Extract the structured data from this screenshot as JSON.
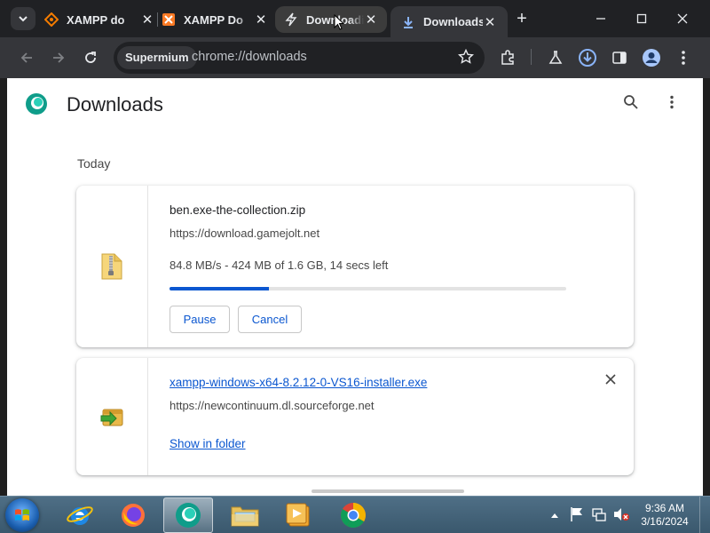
{
  "browser": {
    "tabs": [
      {
        "title": "XAMPP do",
        "icon": "xampp-diamond-icon",
        "active": false
      },
      {
        "title": "XAMPP Do",
        "icon": "xampp-logo-icon",
        "active": false
      },
      {
        "title": "Downloadi",
        "icon": "lightning-icon",
        "active": false,
        "hovered": true
      },
      {
        "title": "Downloads",
        "icon": "download-arrow-icon",
        "active": true
      }
    ],
    "profile_chip": "Supermium",
    "url": "chrome://downloads",
    "accent": "#0b57d0"
  },
  "page": {
    "title": "Downloads",
    "section_date": "Today",
    "downloads": [
      {
        "filename": "ben.exe-the-collection.zip",
        "source": "https://download.gamejolt.net",
        "status": "84.8 MB/s - 424 MB of 1.6 GB, 14 secs left",
        "progress": 0.25,
        "icon": "zip-folder-icon",
        "pause_label": "Pause",
        "cancel_label": "Cancel"
      },
      {
        "filename": "xampp-windows-x64-8.2.12-0-VS16-installer.exe",
        "source": "https://newcontinuum.dl.sourceforge.net",
        "icon": "installer-icon",
        "show_in_folder_label": "Show in folder"
      }
    ]
  },
  "taskbar": {
    "apps": [
      "internet-explorer",
      "firefox",
      "supermium",
      "file-explorer",
      "media-player",
      "chrome"
    ],
    "clock_time": "9:36 AM",
    "clock_date": "3/16/2024"
  }
}
